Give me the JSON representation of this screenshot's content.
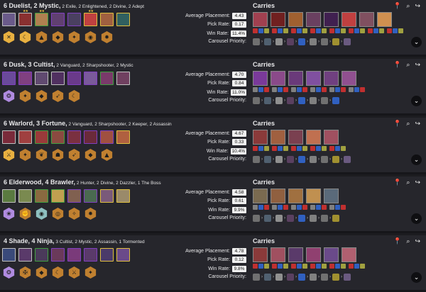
{
  "labels": {
    "avg": "Average Placement:",
    "pick": "Pick Rate:",
    "win": "Win Rate:",
    "carousel": "Carousel Priority:",
    "carries": "Carries",
    "arrow": "›",
    "expand": "⌄",
    "pin_icon": "📍",
    "search_icon": "⌕",
    "share_icon": "↪"
  },
  "comps": [
    {
      "title_main": "6 Duelist, 2 Mystic,",
      "title_rest": " 2 Exile, 2 Enlightened, 2 Divine, 2 Adept",
      "avg": "4.43",
      "pick": "0.17",
      "win": "11.4%",
      "champs": [
        {
          "color": "#6a5a8a",
          "border": "#c0c0c0",
          "stars": ""
        },
        {
          "color": "#8a3030",
          "border": "#c0c0c0",
          "stars": "★★"
        },
        {
          "color": "#b08050",
          "border": "#40a040",
          "stars": "★★"
        },
        {
          "color": "#604070",
          "border": "#8040c0",
          "stars": ""
        },
        {
          "color": "#4a4060",
          "border": "#8040c0",
          "stars": ""
        },
        {
          "color": "#c04040",
          "border": "#e0c040",
          "stars": "★★"
        },
        {
          "color": "#a06040",
          "border": "#e0c040",
          "stars": ""
        },
        {
          "color": "#306060",
          "border": "#e0c040",
          "stars": ""
        }
      ],
      "traits": [
        {
          "color": "#e8b040",
          "glyph": "✕"
        },
        {
          "color": "#e8b040",
          "glyph": "☾"
        },
        {
          "color": "#c08030",
          "glyph": "▲"
        },
        {
          "color": "#c08030",
          "glyph": "◆"
        },
        {
          "color": "#c08030",
          "glyph": "✦"
        },
        {
          "color": "#c08030",
          "glyph": "◉"
        },
        {
          "color": "#c08030",
          "glyph": "✹"
        }
      ],
      "carries": [
        "#a04050",
        "#702020",
        "#a06030",
        "#6a4060",
        "#402050",
        "#c04040",
        "#805060",
        "#d09050"
      ],
      "item_colors": [
        "#c03030",
        "#3060c0",
        "#a0a040"
      ],
      "carousel_colors": [
        "#707070",
        "#506070",
        "#909090",
        "#5a4060",
        "#3060c0",
        "#808080",
        "#707070",
        "#a09030",
        "#6a5a80"
      ]
    },
    {
      "title_main": "6 Dusk, 3 Cultist,",
      "title_rest": " 2 Vanguard, 2 Sharpshooter, 2 Mystic",
      "avg": "4.70",
      "pick": "0.84",
      "win": "11.0%",
      "champs": [
        {
          "color": "#6a4a9a",
          "border": "#8040c0",
          "stars": ""
        },
        {
          "color": "#804080",
          "border": "#8040c0",
          "stars": ""
        },
        {
          "color": "#604a70",
          "border": "#c0c0c0",
          "stars": ""
        },
        {
          "color": "#503060",
          "border": "#c0c0c0",
          "stars": ""
        },
        {
          "color": "#6a3a8a",
          "border": "#8040c0",
          "stars": ""
        },
        {
          "color": "#7a5a9a",
          "border": "#8040c0",
          "stars": ""
        },
        {
          "color": "#7a3a6a",
          "border": "#40a040",
          "stars": ""
        },
        {
          "color": "#704060",
          "border": "#c0c0c0",
          "stars": ""
        }
      ],
      "traits": [
        {
          "color": "#b08be0",
          "glyph": "❂"
        },
        {
          "color": "#c08030",
          "glyph": "✦"
        },
        {
          "color": "#c08030",
          "glyph": "◆"
        },
        {
          "color": "#c08030",
          "glyph": "➶"
        },
        {
          "color": "#c08030",
          "glyph": "☾"
        }
      ],
      "carries": [
        "#7a3a9a",
        "#8a4a8a",
        "#6a3a7a",
        "#8050a0",
        "#704080",
        "#905090"
      ],
      "item_colors": [
        "#808080",
        "#3060c0",
        "#c03030"
      ],
      "carousel_colors": [
        "#707070",
        "#506070",
        "#909090",
        "#5a4060",
        "#3060c0",
        "#808080",
        "#707070",
        "#3060c0"
      ]
    },
    {
      "title_main": "6 Warlord, 3 Fortune,",
      "title_rest": " 2 Vanguard, 2 Sharpshooter, 2 Keeper, 2 Assassin",
      "avg": "4.67",
      "pick": "0.33",
      "win": "10.4%",
      "champs": [
        {
          "color": "#7a2a3a",
          "border": "#c0c0c0",
          "stars": ""
        },
        {
          "color": "#a04040",
          "border": "#c0c0c0",
          "stars": ""
        },
        {
          "color": "#9a3a3a",
          "border": "#40a040",
          "stars": ""
        },
        {
          "color": "#8a4a40",
          "border": "#40a040",
          "stars": ""
        },
        {
          "color": "#7a3040",
          "border": "#8040c0",
          "stars": ""
        },
        {
          "color": "#6a2a3a",
          "border": "#8040c0",
          "stars": ""
        },
        {
          "color": "#a05040",
          "border": "#8040c0",
          "stars": ""
        },
        {
          "color": "#b06040",
          "border": "#e0c040",
          "stars": ""
        }
      ],
      "traits": [
        {
          "color": "#e8b040",
          "glyph": "⚔"
        },
        {
          "color": "#c08030",
          "glyph": "✦"
        },
        {
          "color": "#c08030",
          "glyph": "❦"
        },
        {
          "color": "#c08030",
          "glyph": "☗"
        },
        {
          "color": "#c08030",
          "glyph": "➶"
        },
        {
          "color": "#c08030",
          "glyph": "◆"
        },
        {
          "color": "#c08030",
          "glyph": "▲"
        }
      ],
      "carries": [
        "#8a3a3a",
        "#a06040",
        "#7a4050",
        "#c07050",
        "#a05060"
      ],
      "item_colors": [
        "#c03030",
        "#3060c0",
        "#a0a040"
      ],
      "carousel_colors": [
        "#707070",
        "#506070",
        "#909090",
        "#5a4060",
        "#3060c0",
        "#808080",
        "#707070",
        "#a09030",
        "#6a5a80"
      ]
    },
    {
      "title_main": "6 Elderwood, 4 Brawler,",
      "title_rest": " 2 Hunter, 2 Divine, 2 Dazzler, 1 The Boss",
      "avg": "4.58",
      "pick": "0.61",
      "win": "9.9%",
      "champs": [
        {
          "color": "#5a7a40",
          "border": "#c0c0c0",
          "stars": ""
        },
        {
          "color": "#7a8a50",
          "border": "#c0c0c0",
          "stars": ""
        },
        {
          "color": "#8a6a40",
          "border": "#40a040",
          "stars": ""
        },
        {
          "color": "#c0a050",
          "border": "#40a040",
          "stars": ""
        },
        {
          "color": "#806050",
          "border": "#8040c0",
          "stars": ""
        },
        {
          "color": "#4a6a50",
          "border": "#8040c0",
          "stars": ""
        },
        {
          "color": "#7a5a7a",
          "border": "#e0c040",
          "stars": ""
        },
        {
          "color": "#9a8a6a",
          "border": "#e0c040",
          "stars": ""
        }
      ],
      "traits": [
        {
          "color": "#b08be0",
          "glyph": "❀"
        },
        {
          "color": "#c08030",
          "glyph": "✊"
        },
        {
          "color": "#8ec0c0",
          "glyph": "◉"
        },
        {
          "color": "#c08030",
          "glyph": "◎"
        },
        {
          "color": "#c08030",
          "glyph": "✧"
        },
        {
          "color": "#c08030",
          "glyph": "✹"
        }
      ],
      "carries": [
        "#7a6a50",
        "#906040",
        "#a07040",
        "#c09050",
        "#5a6a7a"
      ],
      "item_colors": [
        "#808080",
        "#3060c0",
        "#c03030"
      ],
      "carousel_colors": [
        "#707070",
        "#506070",
        "#909090",
        "#5a4060",
        "#3060c0",
        "#808080",
        "#707070",
        "#a09030"
      ]
    },
    {
      "title_main": "4 Shade, 4 Ninja,",
      "title_rest": " 3 Cultist, 2 Mystic, 2 Assassin, 1 Tormented",
      "avg": "4.78",
      "pick": "0.12",
      "win": "9.8%",
      "champs": [
        {
          "color": "#3a4a7a",
          "border": "#c0c0c0",
          "stars": ""
        },
        {
          "color": "#5a3a6a",
          "border": "#c0c0c0",
          "stars": ""
        },
        {
          "color": "#4a3a5a",
          "border": "#40a040",
          "stars": ""
        },
        {
          "color": "#6a3a5a",
          "border": "#8040c0",
          "stars": ""
        },
        {
          "color": "#7a3a7a",
          "border": "#8040c0",
          "stars": ""
        },
        {
          "color": "#5a3a6a",
          "border": "#8040c0",
          "stars": ""
        },
        {
          "color": "#4a3a6a",
          "border": "#e0c040",
          "stars": ""
        },
        {
          "color": "#6a4a8a",
          "border": "#e0c040",
          "stars": ""
        }
      ],
      "traits": [
        {
          "color": "#b08be0",
          "glyph": "❂"
        },
        {
          "color": "#c08030",
          "glyph": "✠"
        },
        {
          "color": "#c08030",
          "glyph": "◆"
        },
        {
          "color": "#c08030",
          "glyph": "☾"
        },
        {
          "color": "#c08030",
          "glyph": "⚔"
        },
        {
          "color": "#c08030",
          "glyph": "✦"
        }
      ],
      "carries": [
        "#8a3a3a",
        "#a05060",
        "#5a3a6a",
        "#904070",
        "#6a4a8a",
        "#b06070"
      ],
      "item_colors": [
        "#c03030",
        "#3060c0",
        "#a0a040"
      ],
      "carousel_colors": [
        "#707070",
        "#506070",
        "#909090",
        "#5a4060",
        "#3060c0",
        "#808080",
        "#707070",
        "#a09030",
        "#6a5a80"
      ]
    }
  ]
}
